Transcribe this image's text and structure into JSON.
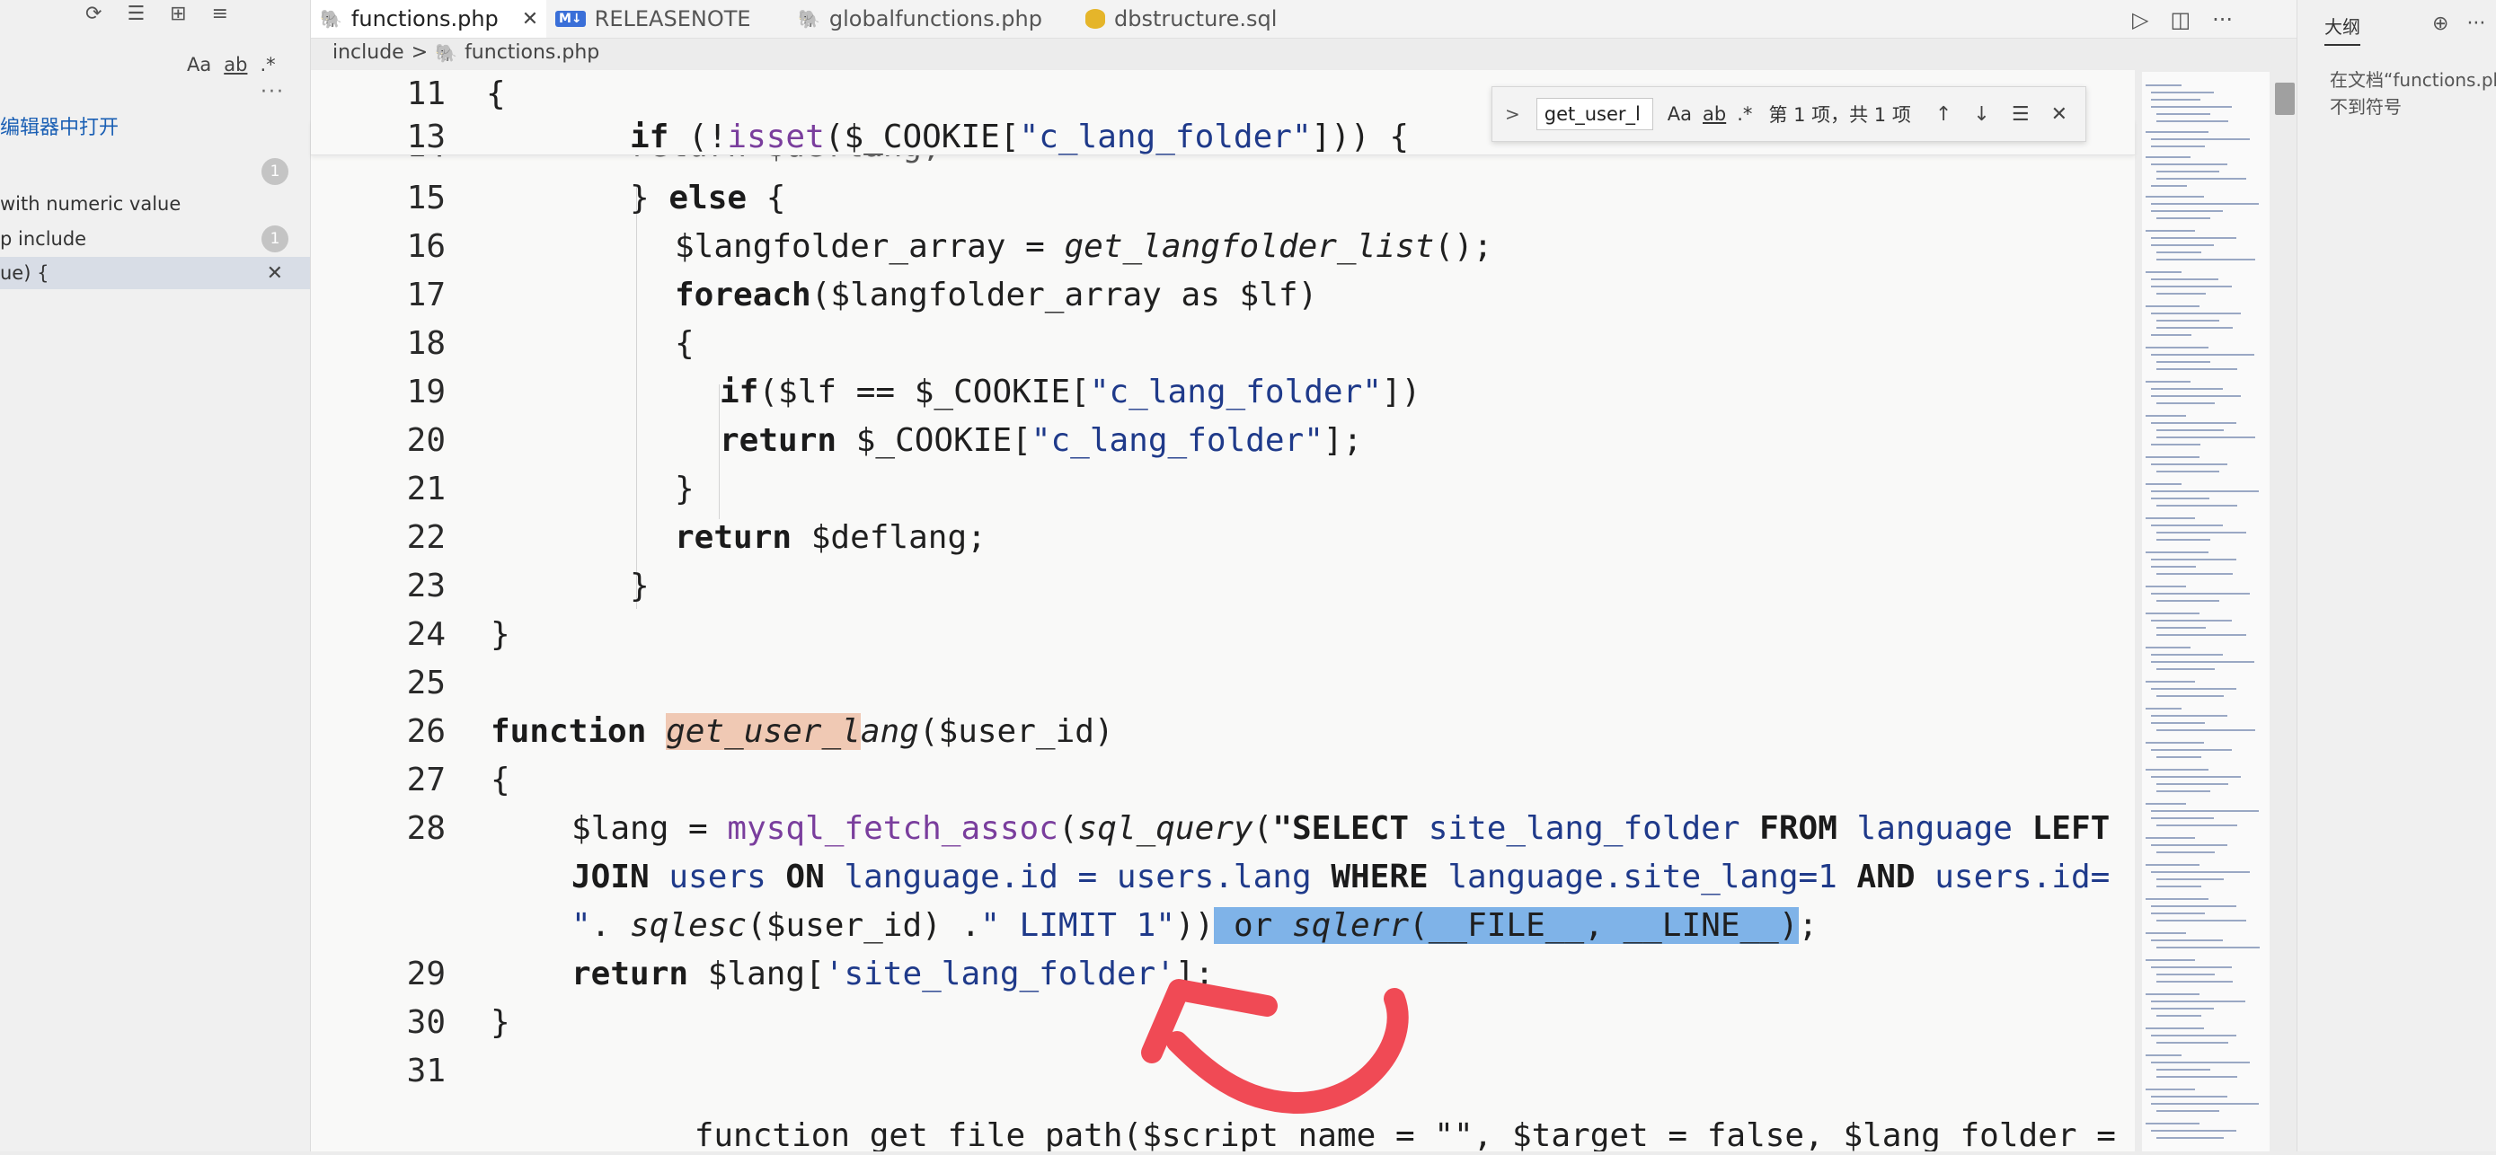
{
  "sidebar": {
    "top_icons": [
      "refresh-icon",
      "collapse-all-icon",
      "new-search-editor-icon",
      "clear-icon"
    ],
    "options": {
      "match_case": "Aa",
      "whole_word": "ab",
      "regex": ".*"
    },
    "more": "···",
    "open_in_editor": "在编辑器中打开",
    "results": [
      {
        "text": "",
        "badge": "1"
      },
      {
        "text": "with numeric value",
        "badge": ""
      },
      {
        "text": "p  include",
        "badge": "1"
      },
      {
        "text": "ue) {",
        "badge": "",
        "close": "✕"
      }
    ]
  },
  "tabs": [
    {
      "label": "functions.php",
      "close": "✕",
      "active": true
    },
    {
      "label": "RELEASENOTE",
      "icon_text": "M↓"
    },
    {
      "label": "globalfunctions.php"
    },
    {
      "label": "dbstructure.sql"
    }
  ],
  "editor_actions": [
    "run-icon",
    "split-editor-icon",
    "more-actions-icon"
  ],
  "breadcrumb": {
    "folder": "include",
    "separator": ">",
    "file": "functions.php"
  },
  "find_widget": {
    "query": "get_user_l",
    "match_case": "Aa",
    "whole_word": "ab",
    "regex": ".*",
    "result": "第 1 项，共 1 项",
    "prev": "↑",
    "next": "↓",
    "selection": "☰",
    "close": "✕"
  },
  "code_lines": {
    "l11": {
      "num": "11",
      "text": "{"
    },
    "l13": {
      "num": "13"
    },
    "l14": {
      "num": "14",
      "text": "return $deflang;"
    },
    "l15": {
      "num": "15"
    },
    "l16": {
      "num": "16"
    },
    "l17": {
      "num": "17"
    },
    "l18": {
      "num": "18",
      "text": "{"
    },
    "l19": {
      "num": "19"
    },
    "l20": {
      "num": "20"
    },
    "l21": {
      "num": "21",
      "text": "}"
    },
    "l22": {
      "num": "22"
    },
    "l23": {
      "num": "23",
      "text": "}"
    },
    "l24": {
      "num": "24",
      "text": "}"
    },
    "l25": {
      "num": "25"
    },
    "l26": {
      "num": "26"
    },
    "l27": {
      "num": "27",
      "text": "{"
    },
    "l28": {
      "num": "28"
    },
    "l29": {
      "num": "29"
    },
    "l30": {
      "num": "30",
      "text": "}"
    },
    "l31": {
      "num": "31"
    },
    "l32": {
      "text": "    function get_file_path($script_name = \"\", $target = false, $lang_folder = \"\")"
    }
  },
  "outline": {
    "title": "大纲",
    "message_line1": "在文档“functions.php”中找",
    "message_line2": "不到符号"
  },
  "colors": {
    "selection": "#7fb3e8",
    "find_match": "#f0c9b4",
    "arrow": "#f04a55"
  }
}
